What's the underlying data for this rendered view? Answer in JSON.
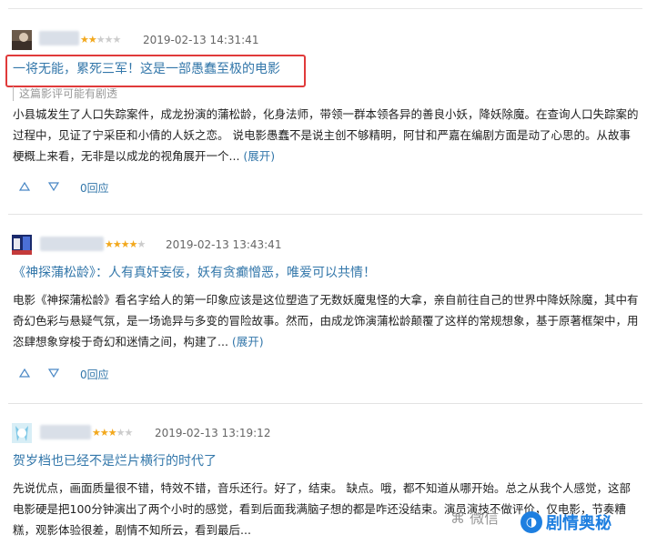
{
  "reviews": [
    {
      "username": "",
      "rating": 2,
      "max_rating": 5,
      "timestamp": "2019-02-13 14:31:41",
      "title": "一将无能，累死三军！这是一部愚蠢至极的电影",
      "spoiler_note": "这篇影评可能有剧透",
      "body": "小县城发生了人口失踪案件，成龙扮演的蒲松龄，化身法师，带领一群本领各异的善良小妖，降妖除魔。在查询人口失踪案的过程中，见证了宁采臣和小倩的人妖之恋。 说电影愚蠢不是说主创不够精明，阿甘和严嘉在编剧方面是动了心思的。从故事梗概上来看，无非是以成龙的视角展开一个...",
      "expand_label": "(展开)",
      "reply_label": "0回应"
    },
    {
      "username": "",
      "rating": 4,
      "max_rating": 5,
      "timestamp": "2019-02-13 13:43:41",
      "title": "《神探蒲松龄》：人有真奸妄佞，妖有贪癫憎恶，唯爱可以共情！",
      "body": "电影《神探蒲松龄》看名字给人的第一印象应该是这位塑造了无数妖魔鬼怪的大拿，亲自前往自己的世界中降妖除魔，其中有奇幻色彩与悬疑气氛，是一场诡异与多变的冒险故事。然而，由成龙饰演蒲松龄颠覆了这样的常规想象，基于原著框架中，用恣肆想象穿梭于奇幻和迷情之间，构建了...",
      "expand_label": "(展开)",
      "reply_label": "0回应"
    },
    {
      "username": "",
      "rating": 3,
      "max_rating": 5,
      "timestamp": "2019-02-13 13:19:12",
      "title": "贺岁档也已经不是烂片横行的时代了",
      "body": "先说优点，画面质量很不错，特效不错，音乐还行。好了，结束。 缺点。哦，都不知道从哪开始。总之从我个人感觉，这部电影硬是把100分钟演出了两个小时的感觉，看到后面我满脑子想的都是咋还没结束。演员演技不做评价，仅电影，节奏糟糕，观影体验很差，剧情不知所云，看到最后..."
    }
  ],
  "watermark": {
    "wechat_label": "微信",
    "brand_name": "剧情奥秘"
  },
  "colors": {
    "link": "#3377aa",
    "star": "#f2a81d",
    "highlight_box": "#e03a3a",
    "brand": "#1e7fe0"
  }
}
